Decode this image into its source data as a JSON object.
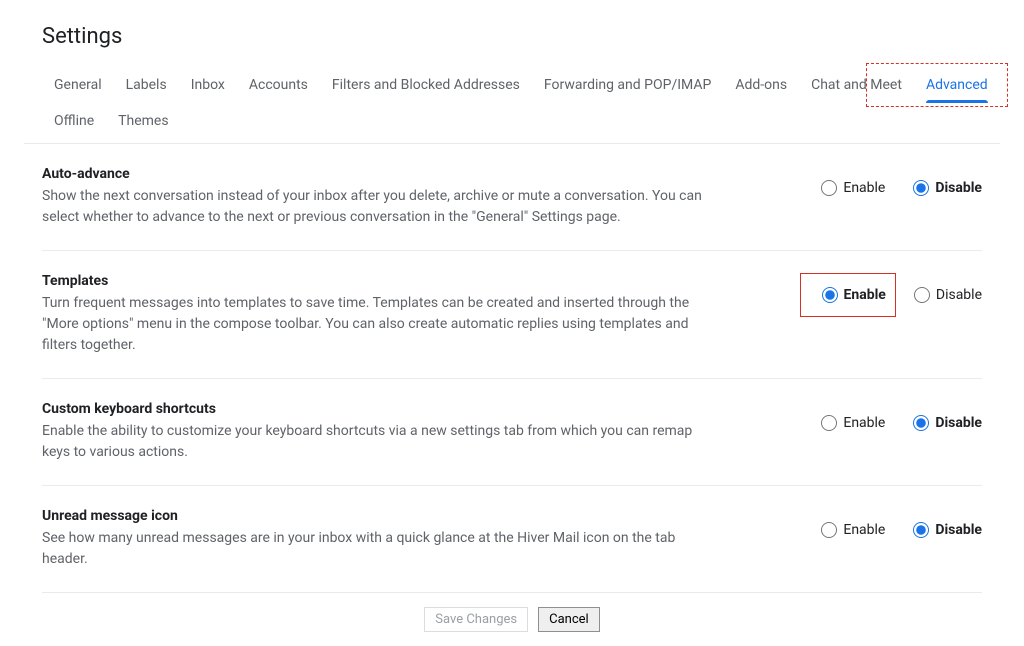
{
  "page_title": "Settings",
  "tabs": [
    {
      "label": "General"
    },
    {
      "label": "Labels"
    },
    {
      "label": "Inbox"
    },
    {
      "label": "Accounts"
    },
    {
      "label": "Filters and Blocked Addresses"
    },
    {
      "label": "Forwarding and POP/IMAP"
    },
    {
      "label": "Add-ons"
    },
    {
      "label": "Chat and Meet"
    },
    {
      "label": "Advanced",
      "active": true
    },
    {
      "label": "Offline"
    },
    {
      "label": "Themes"
    }
  ],
  "enable_label": "Enable",
  "disable_label": "Disable",
  "settings": [
    {
      "title": "Auto-advance",
      "desc": "Show the next conversation instead of your inbox after you delete, archive or mute a conversation. You can select whether to advance to the next or previous conversation in the \"General\" Settings page.",
      "selected": "disable"
    },
    {
      "title": "Templates",
      "desc": "Turn frequent messages into templates to save time. Templates can be created and inserted through the \"More options\" menu in the compose toolbar. You can also create automatic replies using templates and filters together.",
      "selected": "enable",
      "highlight_enable": true
    },
    {
      "title": "Custom keyboard shortcuts",
      "desc": "Enable the ability to customize your keyboard shortcuts via a new settings tab from which you can remap keys to various actions.",
      "selected": "disable"
    },
    {
      "title": "Unread message icon",
      "desc": "See how many unread messages are in your inbox with a quick glance at the Hiver Mail icon on the tab header.",
      "selected": "disable"
    }
  ],
  "buttons": {
    "save": "Save Changes",
    "cancel": "Cancel"
  }
}
